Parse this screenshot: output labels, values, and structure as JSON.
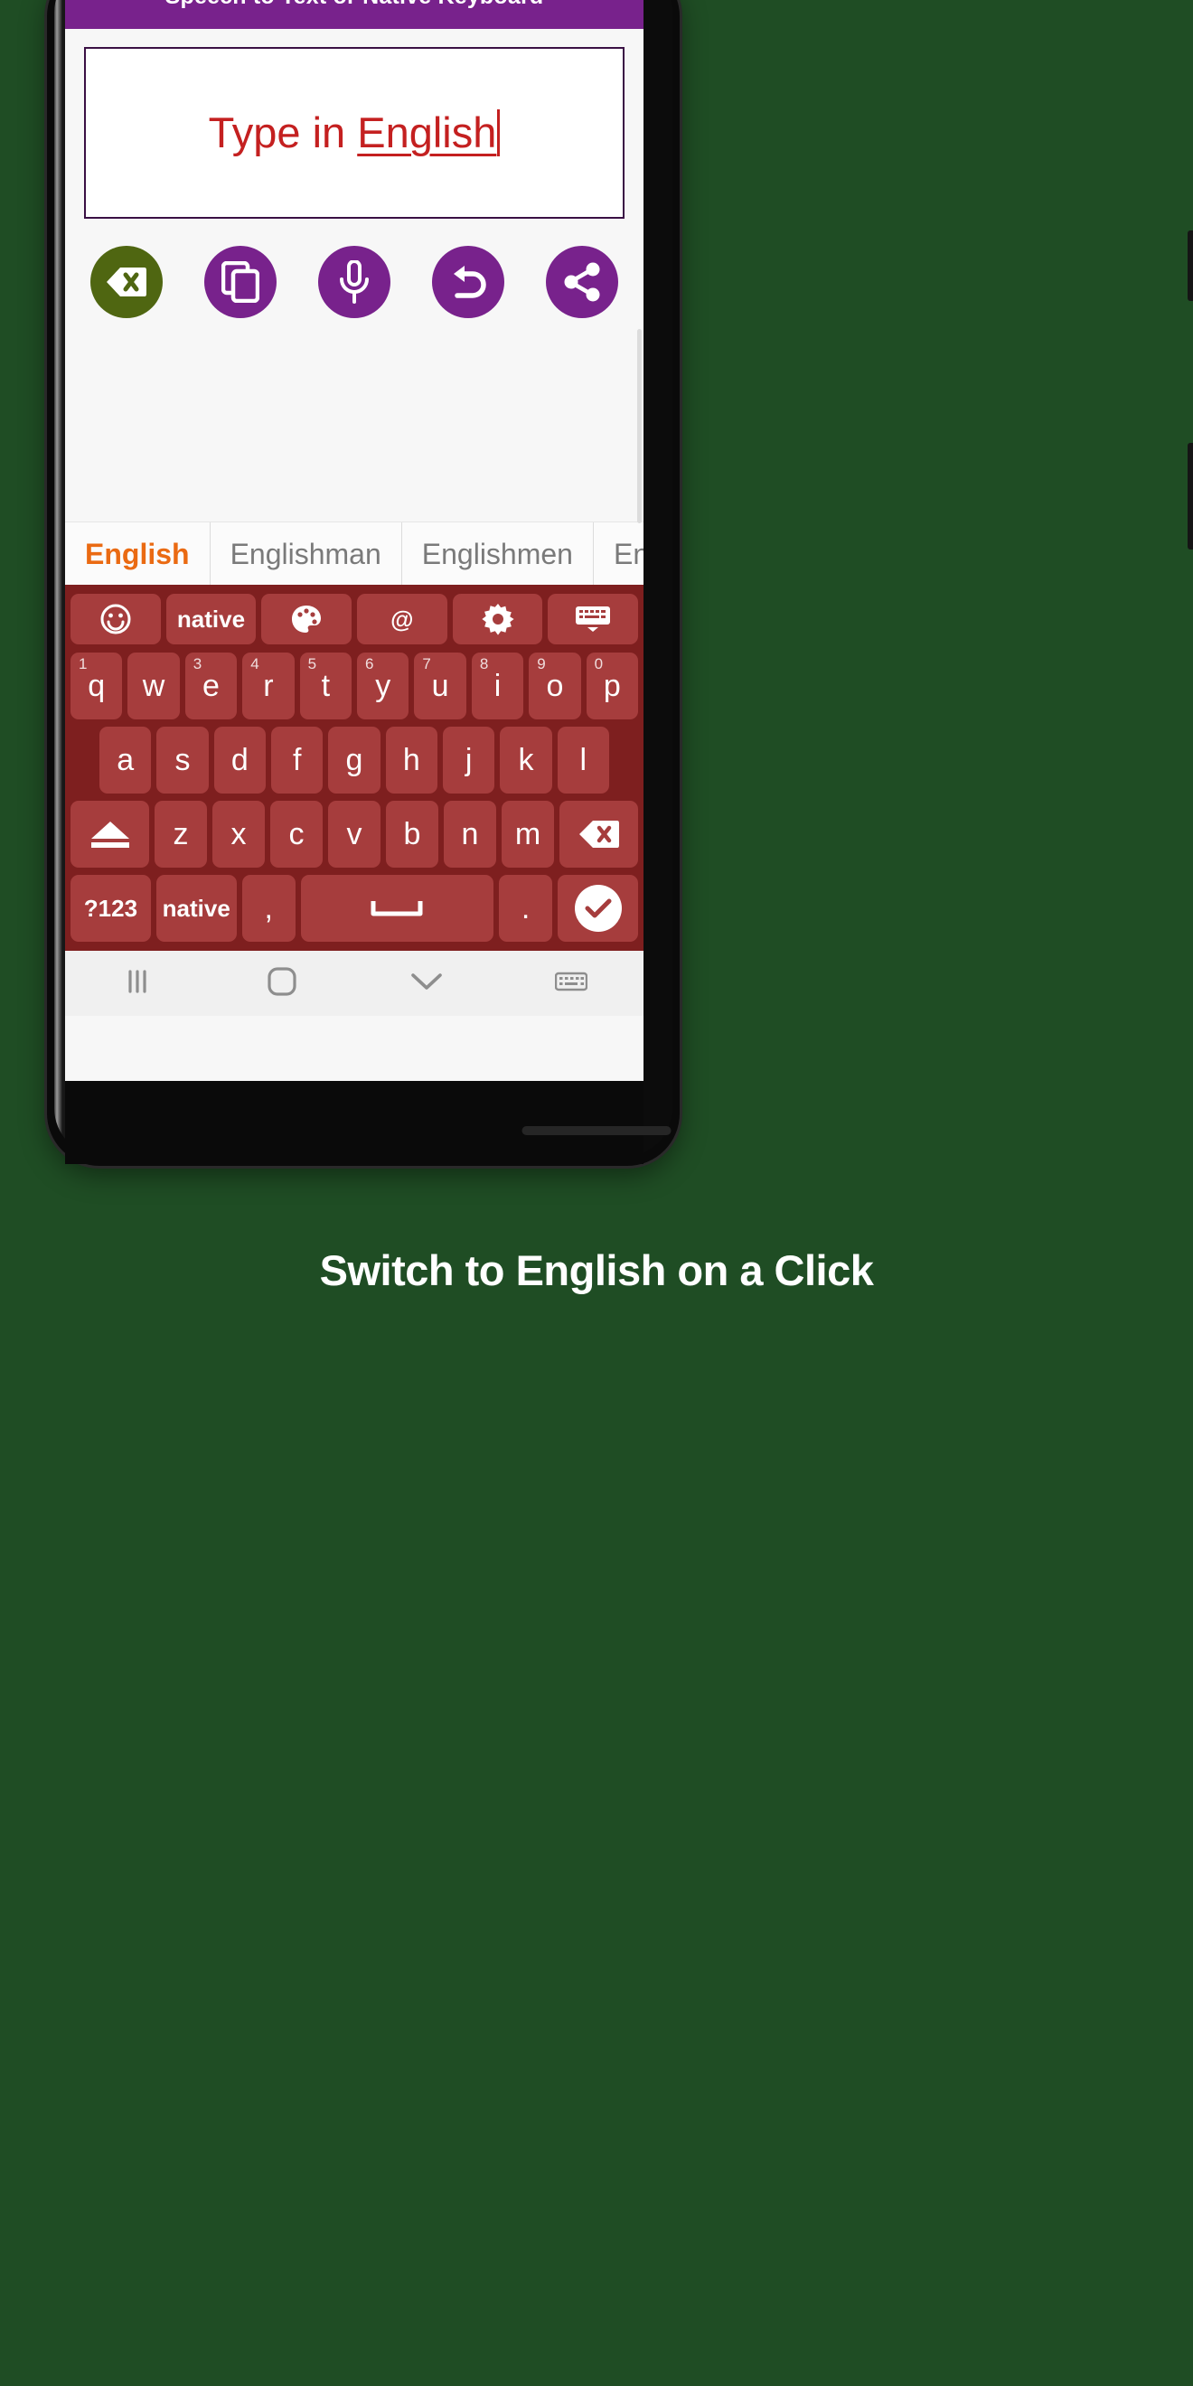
{
  "colors": {
    "page_background": "#1f4d24",
    "header_purple": "#78228c",
    "accent_red_text": "#c42020",
    "keyboard_background": "#7e1f1f",
    "key_face": "#a63d3d",
    "suggestion_active": "#ea6a12",
    "backspace_button": "#4f6611"
  },
  "app": {
    "header_title": "Speech to Text or Native Keyboard"
  },
  "text_field": {
    "value_prefix": "Type in ",
    "value_underlined": "English",
    "full_value": "Type in English",
    "caret_visible": true
  },
  "action_buttons": [
    {
      "name": "backspace-delete-icon",
      "label": "Clear"
    },
    {
      "name": "copy-icon",
      "label": "Copy"
    },
    {
      "name": "microphone-icon",
      "label": "Speak"
    },
    {
      "name": "undo-icon",
      "label": "Undo"
    },
    {
      "name": "share-icon",
      "label": "Share"
    }
  ],
  "suggestions": [
    {
      "text": "English",
      "active": true
    },
    {
      "text": "Englishman",
      "active": false
    },
    {
      "text": "Englishmen",
      "active": false
    },
    {
      "text": "Eng",
      "active": false
    }
  ],
  "keyboard": {
    "function_row": [
      {
        "label": "",
        "icon": "emoji-smiley-icon"
      },
      {
        "label": "native",
        "icon": ""
      },
      {
        "label": "",
        "icon": "palette-theme-icon"
      },
      {
        "label": "@",
        "icon": ""
      },
      {
        "label": "",
        "icon": "settings-gear-icon"
      },
      {
        "label": "",
        "icon": "keyboard-hide-icon"
      }
    ],
    "row1": [
      {
        "key": "q",
        "sup": "1"
      },
      {
        "key": "w",
        "sup": ""
      },
      {
        "key": "e",
        "sup": "3"
      },
      {
        "key": "r",
        "sup": "4"
      },
      {
        "key": "t",
        "sup": "5"
      },
      {
        "key": "y",
        "sup": "6"
      },
      {
        "key": "u",
        "sup": "7"
      },
      {
        "key": "i",
        "sup": "8"
      },
      {
        "key": "o",
        "sup": "9"
      },
      {
        "key": "p",
        "sup": "0"
      }
    ],
    "row2": [
      "a",
      "s",
      "d",
      "f",
      "g",
      "h",
      "j",
      "k",
      "l"
    ],
    "row3": {
      "shift": "shift-caps-icon",
      "letters": [
        "z",
        "x",
        "c",
        "v",
        "b",
        "n",
        "m"
      ],
      "backspace": "backspace-icon"
    },
    "row4": {
      "symbols": "?123",
      "language": "native",
      "comma": ",",
      "space": "space-bar-icon",
      "period": ".",
      "enter": "check-enter-icon"
    }
  },
  "nav_bar": [
    {
      "name": "recents-icon",
      "glyph": "|||"
    },
    {
      "name": "home-icon",
      "glyph": "home"
    },
    {
      "name": "back-chevron-icon",
      "glyph": "v"
    },
    {
      "name": "keyboard-indicator-icon",
      "glyph": "keyboard"
    }
  ],
  "caption": {
    "text": "Switch to English on a Click"
  }
}
